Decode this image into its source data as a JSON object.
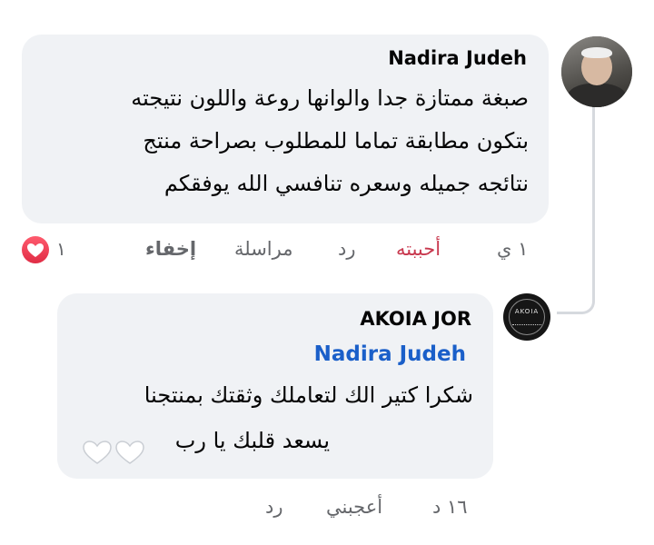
{
  "comment": {
    "author": "Nadira Judeh",
    "lines": [
      "صبغة ممتازة جدا والوانها روعة واللون نتيجته",
      "بتكون مطابقة تماما للمطلوب بصراحة منتج",
      "نتائجه جميله وسعره تنافسي الله يوفقكم"
    ],
    "time": "١ ي",
    "actions": {
      "liked": "أحببته",
      "reply": "رد",
      "message": "مراسلة",
      "hide": "إخفاء"
    },
    "reaction": {
      "icon": "heart-icon",
      "count": "١",
      "color": "#e02c45"
    }
  },
  "reply": {
    "author": "AKOIA JOR",
    "avatar_text": "AKOIA",
    "mention": "Nadira Judeh",
    "lines": [
      "شكرا كتير الك لتعاملك وثقتك بمنتجنا",
      "يسعد قلبك يا رب"
    ],
    "emoji": "white-heart-icon",
    "time": "١٦ د",
    "actions": {
      "like": "أعجبني",
      "reply": "رد"
    }
  },
  "colors": {
    "bubble": "#f0f2f5",
    "mention": "#1a5fc9",
    "liked": "#c8384e",
    "meta": "#65676b"
  }
}
